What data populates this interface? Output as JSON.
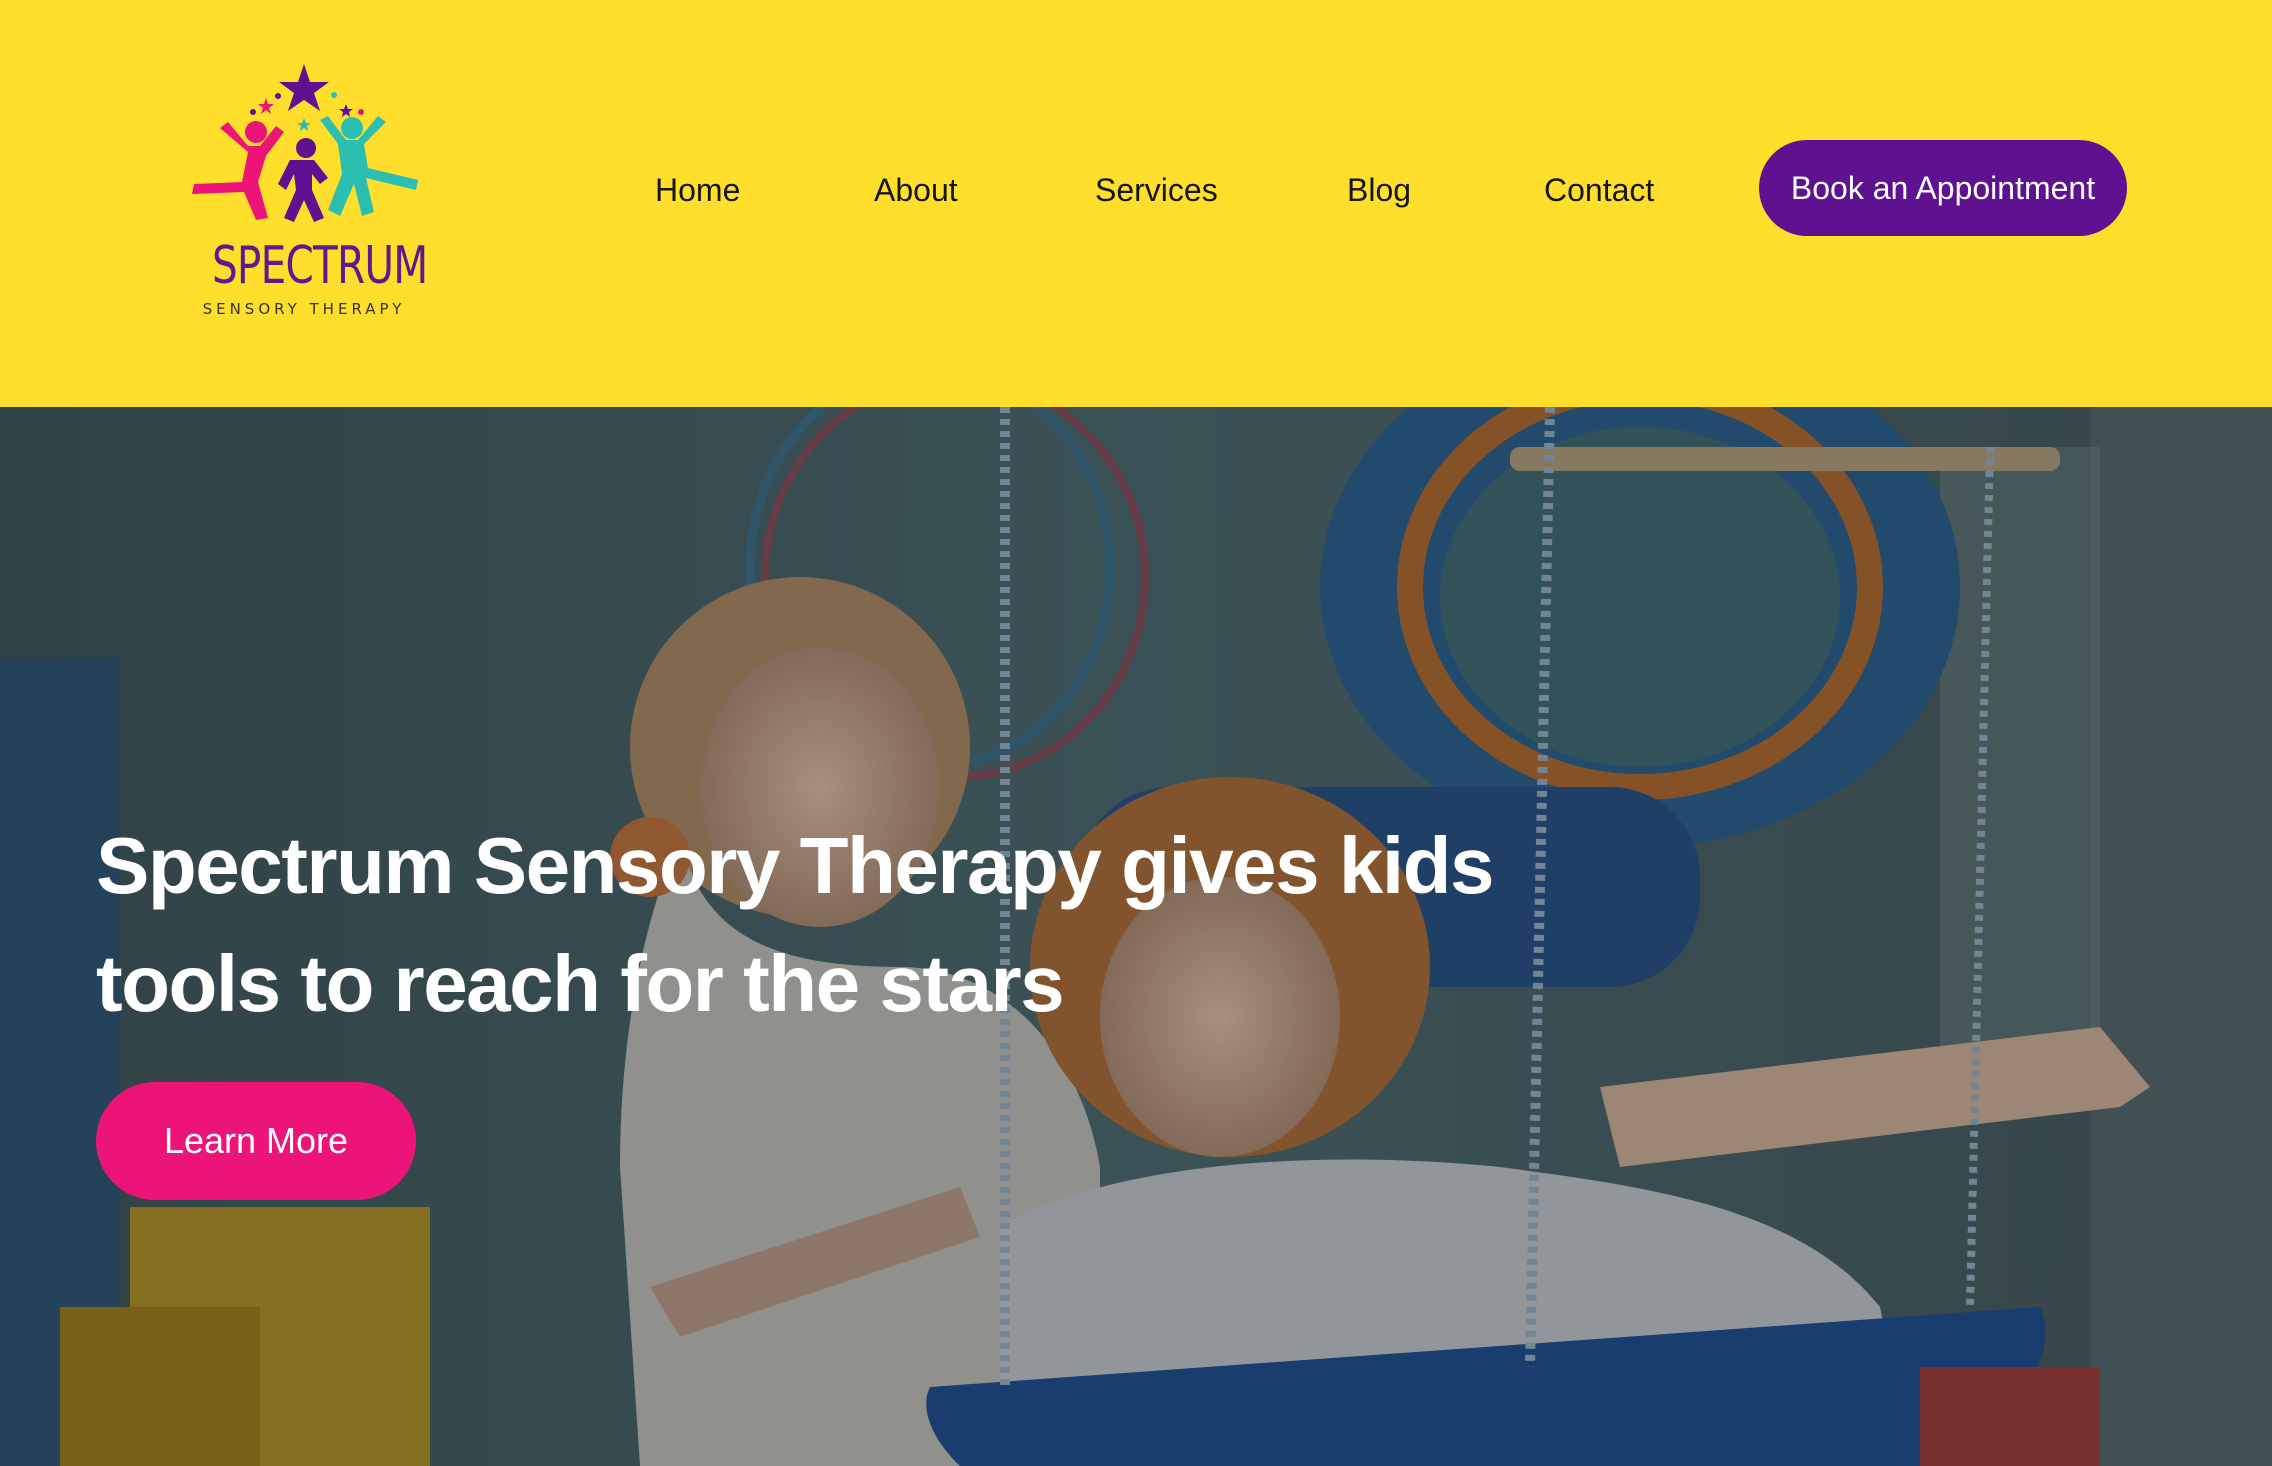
{
  "brand": {
    "name": "SPECTRUM",
    "tagline": "SENSORY THERAPY",
    "colors": {
      "primary": "#5e1190",
      "accent": "#ec1577",
      "header_bg": "#ffdf2b",
      "teal": "#2bbfb1"
    }
  },
  "nav": {
    "items": [
      {
        "label": "Home"
      },
      {
        "label": "About"
      },
      {
        "label": "Services"
      },
      {
        "label": "Blog"
      },
      {
        "label": "Contact"
      }
    ],
    "cta_label": "Book an Appointment"
  },
  "hero": {
    "headline_line1": "Spectrum Sensory Therapy gives kids",
    "headline_line2": "tools to reach for the stars",
    "button_label": "Learn More"
  }
}
